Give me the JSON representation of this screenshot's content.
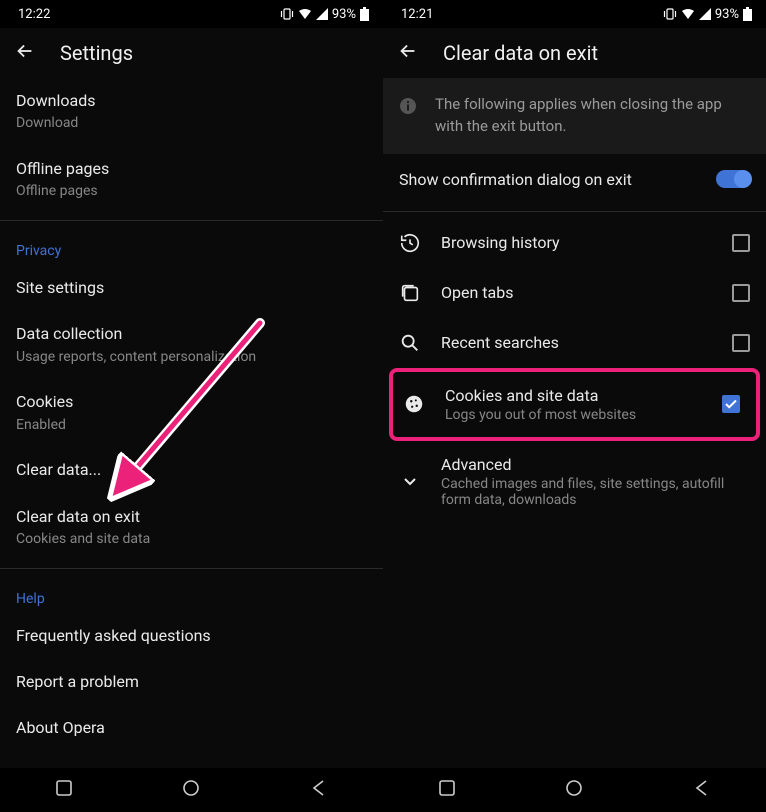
{
  "left": {
    "status": {
      "time": "12:22",
      "battery": "93%"
    },
    "title": "Settings",
    "items": [
      {
        "primary": "Downloads",
        "secondary": "Download"
      },
      {
        "primary": "Offline pages",
        "secondary": "Offline pages"
      }
    ],
    "privacy_header": "Privacy",
    "privacy_items": [
      {
        "primary": "Site settings",
        "secondary": ""
      },
      {
        "primary": "Data collection",
        "secondary": "Usage reports, content personalization"
      },
      {
        "primary": "Cookies",
        "secondary": "Enabled"
      },
      {
        "primary": "Clear data...",
        "secondary": ""
      },
      {
        "primary": "Clear data on exit",
        "secondary": "Cookies and site data"
      }
    ],
    "help_header": "Help",
    "help_items": [
      {
        "primary": "Frequently asked questions"
      },
      {
        "primary": "Report a problem"
      },
      {
        "primary": "About Opera"
      }
    ]
  },
  "right": {
    "status": {
      "time": "12:21",
      "battery": "93%"
    },
    "title": "Clear data on exit",
    "banner": "The following applies when closing the app with the exit button.",
    "toggle_label": "Show confirmation dialog on exit",
    "toggle_on": true,
    "rows": [
      {
        "icon": "history-icon",
        "primary": "Browsing history",
        "secondary": "",
        "checked": false
      },
      {
        "icon": "tabs-icon",
        "primary": "Open tabs",
        "secondary": "",
        "checked": false
      },
      {
        "icon": "search-icon",
        "primary": "Recent searches",
        "secondary": "",
        "checked": false
      },
      {
        "icon": "cookie-icon",
        "primary": "Cookies and site data",
        "secondary": "Logs you out of most websites",
        "checked": true,
        "highlight": true
      },
      {
        "icon": "chevron-down-icon",
        "primary": "Advanced",
        "secondary": "Cached images and files, site settings, autofill form data, downloads",
        "checked": null
      }
    ]
  },
  "annotation": {
    "arrow_color": "#ec227a"
  }
}
